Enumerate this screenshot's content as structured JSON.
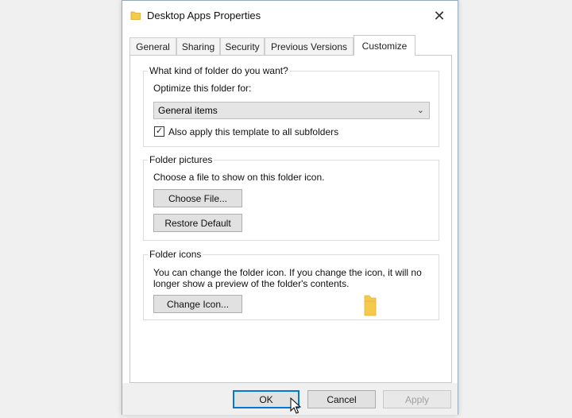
{
  "window": {
    "title": "Desktop Apps Properties",
    "close_glyph": "✕"
  },
  "tabs": [
    {
      "label": "General"
    },
    {
      "label": "Sharing"
    },
    {
      "label": "Security"
    },
    {
      "label": "Previous Versions"
    },
    {
      "label": "Customize",
      "active": true
    }
  ],
  "folder_kind": {
    "title": "What kind of folder do you want?",
    "optimize_label": "Optimize this folder for:",
    "optimize_value": "General items",
    "apply_checked": true,
    "apply_label": "Also apply this template to all subfolders"
  },
  "folder_pictures": {
    "title": "Folder pictures",
    "description": "Choose a file to show on this folder icon.",
    "choose_file": "Choose File...",
    "restore_default": "Restore Default"
  },
  "folder_icons": {
    "title": "Folder icons",
    "description_line1": "You can change the folder icon. If you change the icon, it will no",
    "description_line2": "longer show a preview of the folder's contents.",
    "change_icon": "Change Icon..."
  },
  "footer": {
    "ok": "OK",
    "cancel": "Cancel",
    "apply": "Apply"
  },
  "colors": {
    "folder": "#f5c94a",
    "accent": "#0078d7"
  }
}
